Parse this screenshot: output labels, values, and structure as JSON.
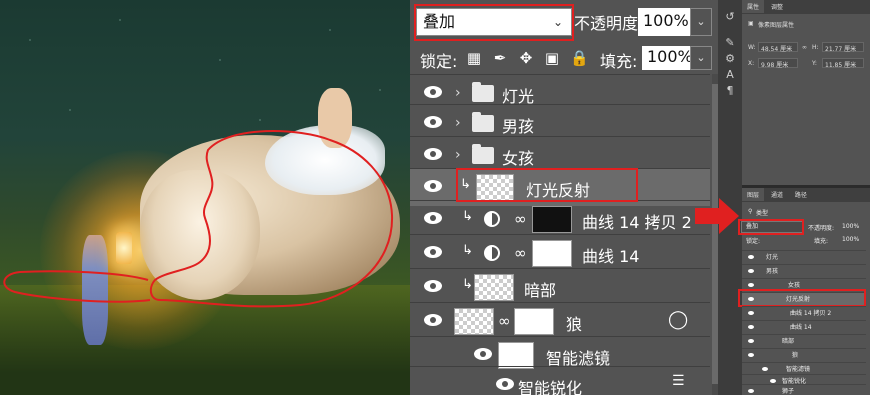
{
  "layers_panel": {
    "blend_mode": "叠加",
    "opacity_label": "不透明度:",
    "opacity_value": "100%",
    "lock_label": "锁定:",
    "fill_label": "填充:",
    "fill_value": "100%",
    "layers": [
      {
        "name": "灯光",
        "type": "group"
      },
      {
        "name": "男孩",
        "type": "group"
      },
      {
        "name": "女孩",
        "type": "group"
      },
      {
        "name": "灯光反射",
        "type": "layer",
        "selected": true
      },
      {
        "name": "曲线 14 拷贝 2",
        "type": "adjustment"
      },
      {
        "name": "曲线 14",
        "type": "adjustment"
      },
      {
        "name": "暗部",
        "type": "layer"
      },
      {
        "name": "狼",
        "type": "smart"
      },
      {
        "name": "智能滤镜",
        "type": "filter"
      },
      {
        "name": "智能锐化",
        "type": "filter-item"
      }
    ]
  },
  "properties_panel": {
    "tabs": [
      "属性",
      "调整"
    ],
    "subtitle": "像素图层属性",
    "w_label": "W:",
    "w_value": "48.54 厘米",
    "h_label": "H:",
    "h_value": "21.77 厘米",
    "x_label": "X:",
    "x_value": "9.98 厘米",
    "y_label": "Y:",
    "y_value": "11.85 厘米"
  },
  "mini_layers": {
    "tabs": [
      "图层",
      "通道",
      "路径"
    ],
    "kind_label": "类型",
    "blend_mode": "叠加",
    "opacity_label": "不透明度:",
    "opacity_value": "100%",
    "lock_label": "锁定:",
    "fill_label": "填充:",
    "fill_value": "100%",
    "rows": [
      "灯光",
      "男孩",
      "女孩",
      "灯光反射",
      "曲线 14 拷贝 2",
      "曲线 14",
      "暗部",
      "狼",
      "智能滤镜",
      "智能锐化",
      "狮子"
    ]
  },
  "colors": {
    "highlight": "#e02020",
    "panel": "#535353"
  }
}
